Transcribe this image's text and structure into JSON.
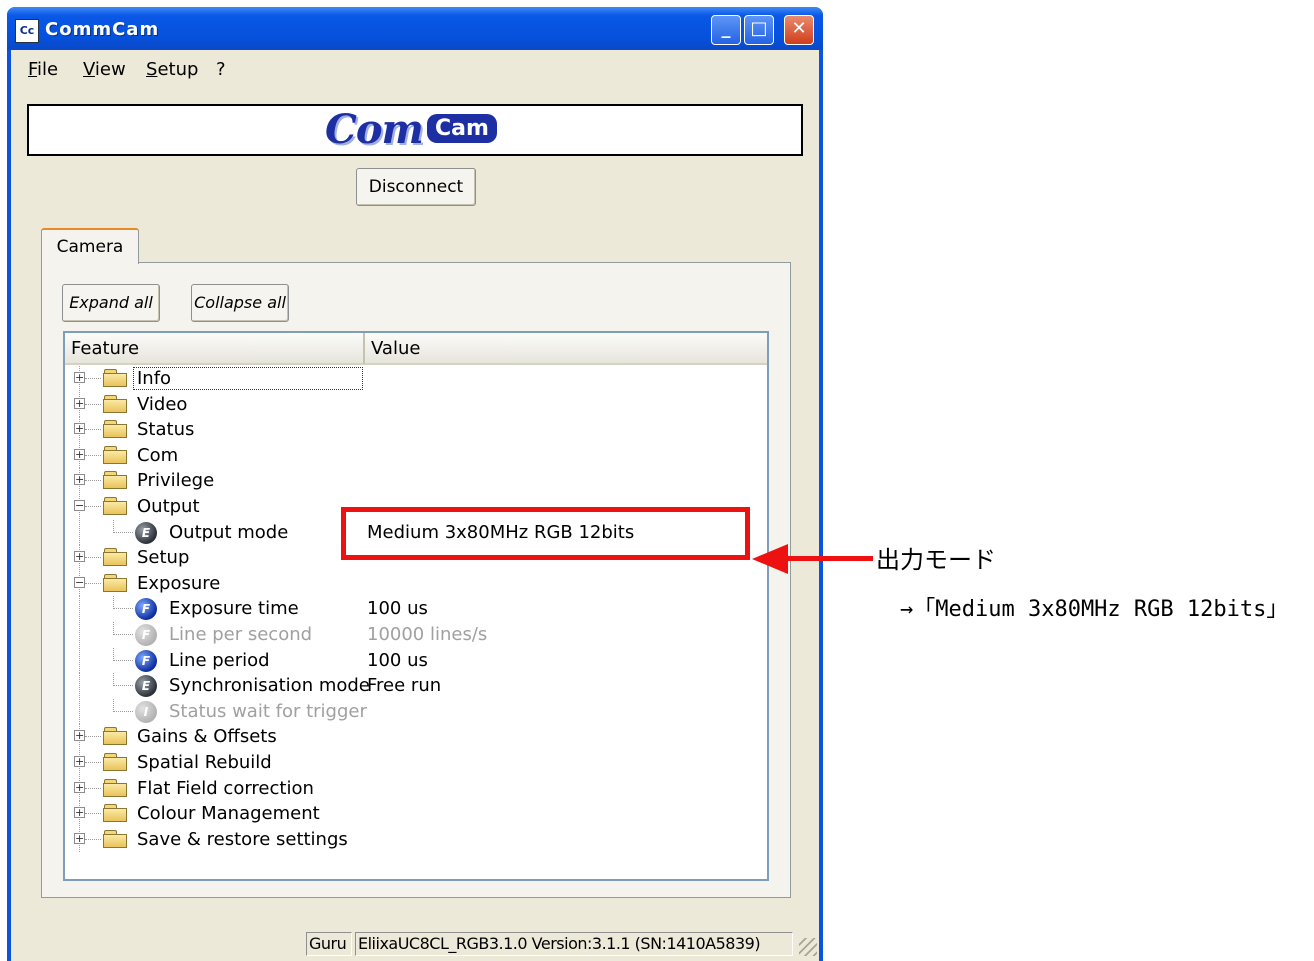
{
  "window": {
    "title": "CommCam",
    "icon_text": "Cc"
  },
  "menu": {
    "file": {
      "hotkey": "F",
      "rest": "ile"
    },
    "view": {
      "hotkey": "V",
      "rest": "iew"
    },
    "setup": {
      "hotkey": "S",
      "rest": "etup"
    },
    "help": "?"
  },
  "logo": {
    "main": "Com",
    "badge": "Cam"
  },
  "buttons": {
    "disconnect": "Disconnect",
    "expand_all": "Expand all",
    "collapse_all": "Collapse all"
  },
  "tabs": [
    {
      "label": "Camera",
      "active": true
    }
  ],
  "tree": {
    "columns": {
      "feature": "Feature",
      "value": "Value"
    },
    "rows": [
      {
        "label": "Info",
        "type": "folder",
        "expanded": false,
        "value": ""
      },
      {
        "label": "Video",
        "type": "folder",
        "expanded": false,
        "value": ""
      },
      {
        "label": "Status",
        "type": "folder",
        "expanded": false,
        "value": ""
      },
      {
        "label": "Com",
        "type": "folder",
        "expanded": false,
        "value": ""
      },
      {
        "label": "Privilege",
        "type": "folder",
        "expanded": false,
        "value": ""
      },
      {
        "label": "Output",
        "type": "folder",
        "expanded": true,
        "value": ""
      },
      {
        "label": "Output mode",
        "type": "feature",
        "icon": "E",
        "value": "Medium 3x80MHz RGB 12bits"
      },
      {
        "label": "Setup",
        "type": "folder",
        "expanded": false,
        "value": ""
      },
      {
        "label": "Exposure",
        "type": "folder",
        "expanded": true,
        "value": ""
      },
      {
        "label": "Exposure time",
        "type": "feature",
        "icon": "F",
        "value": "100 us"
      },
      {
        "label": "Line per second",
        "type": "feature",
        "icon": "F",
        "value": "10000 lines/s",
        "disabled": true
      },
      {
        "label": "Line period",
        "type": "feature",
        "icon": "F",
        "value": "100 us"
      },
      {
        "label": "Synchronisation mode",
        "type": "feature",
        "icon": "E",
        "value": "Free run"
      },
      {
        "label": "Status wait for trigger",
        "type": "feature",
        "icon": "I",
        "value": "",
        "disabled": true
      },
      {
        "label": "Gains & Offsets",
        "type": "folder",
        "expanded": false,
        "value": ""
      },
      {
        "label": "Spatial Rebuild",
        "type": "folder",
        "expanded": false,
        "value": ""
      },
      {
        "label": "Flat Field correction",
        "type": "folder",
        "expanded": false,
        "value": ""
      },
      {
        "label": "Colour Management",
        "type": "folder",
        "expanded": false,
        "value": ""
      },
      {
        "label": "Save & restore settings",
        "type": "folder",
        "expanded": false,
        "value": ""
      }
    ]
  },
  "statusbar": {
    "mode": "Guru",
    "info": "EliixaUC8CL_RGB3.1.0 Version:3.1.1 (SN:1410A5839)"
  },
  "annotation": {
    "title": "出力モード",
    "subtitle": "→「Medium 3x80MHz RGB 12bits」",
    "color": "#ee1111"
  }
}
